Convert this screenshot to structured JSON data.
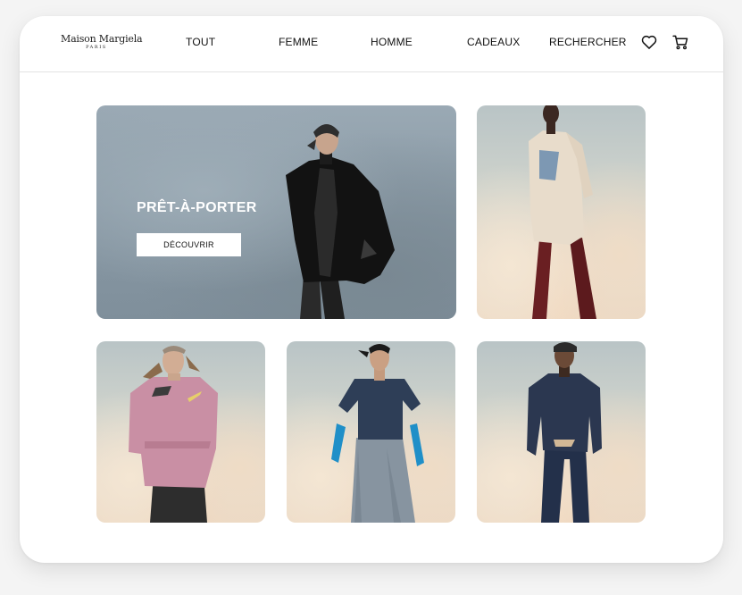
{
  "brand": {
    "name": "Maison Margiela",
    "sub": "PARIS"
  },
  "nav": [
    "TOUT",
    "FEMME",
    "HOMME",
    "CADEAUX",
    "RECHERCHER"
  ],
  "icons": {
    "wishlist": "heart-icon",
    "cart": "cart-icon"
  },
  "hero": {
    "title": "PRÊT-À-PORTER",
    "button_label": "DÉCOUVRIR"
  },
  "colors": {
    "text": "#111111",
    "background": "#ffffff",
    "hero_sky": "#8e9ea9",
    "button": "#ffffff"
  }
}
